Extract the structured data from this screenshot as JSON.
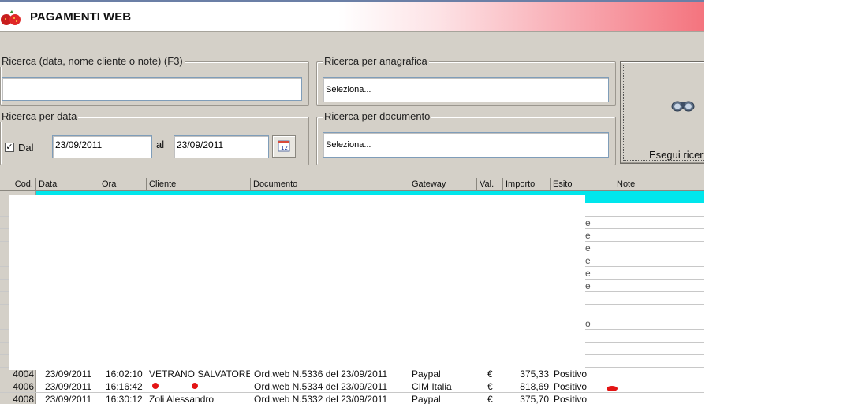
{
  "window": {
    "title": "PAGAMENTI WEB"
  },
  "search_text": {
    "legend": "Ricerca (data, nome cliente o note) (F3)",
    "value": ""
  },
  "search_anagrafica": {
    "legend": "Ricerca per anagrafica",
    "value": "Seleziona..."
  },
  "search_data": {
    "legend": "Ricerca per data",
    "checkbox_label": "Dal",
    "checked": "✓",
    "from_value": "23/09/2011",
    "to_label": "al",
    "to_value": "23/09/2011"
  },
  "search_documento": {
    "legend": "Ricerca per documento",
    "value": "Seleziona..."
  },
  "search_button": {
    "label": "Esegui ricer",
    "icon": "binoculars-icon"
  },
  "table": {
    "columns": [
      "Cod.",
      "Data",
      "Ora",
      "Cliente",
      "Documento",
      "Gateway",
      "Val.",
      "Importo",
      "Esito",
      "Note"
    ],
    "partial_right": [
      "e",
      "e",
      "e",
      "e",
      "e",
      "e",
      "o"
    ],
    "rows": [
      {
        "cod": "4004",
        "data": "23/09/2011",
        "ora": "16:02:10",
        "cliente": "VETRANO SALVATORE",
        "documento": "Ord.web N.5336 del 23/09/2011",
        "gateway": "Paypal",
        "val": "€",
        "importo": "375,33",
        "esito": "Positivo"
      },
      {
        "cod": "4006",
        "data": "23/09/2011",
        "ora": "16:16:42",
        "cliente": "",
        "documento": "Ord.web N.5334 del 23/09/2011",
        "gateway": "CIM Italia",
        "val": "€",
        "importo": "818,69",
        "esito": "Positivo"
      },
      {
        "cod": "4008",
        "data": "23/09/2011",
        "ora": "16:30:12",
        "cliente": "Zoli Alessandro",
        "documento": "Ord.web N.5332 del 23/09/2011",
        "gateway": "Paypal",
        "val": "€",
        "importo": "375,70",
        "esito": "Positivo"
      }
    ]
  },
  "colors": {
    "selection": "#00e6ec",
    "window_bg": "#d4d0c8",
    "title_gradient_end": "#f4747e"
  }
}
